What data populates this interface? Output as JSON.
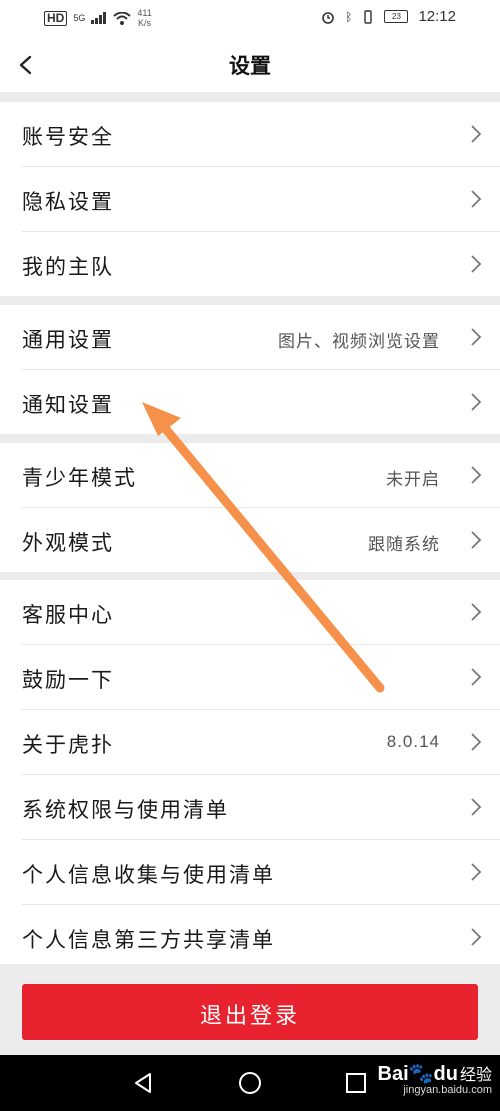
{
  "status_bar": {
    "network": "HD",
    "signal": "5G",
    "speed_value": "411",
    "speed_unit": "K/s",
    "battery": "23",
    "time": "12:12"
  },
  "nav": {
    "title": "设置"
  },
  "groups": [
    {
      "items": [
        {
          "label": "账号安全",
          "value": ""
        },
        {
          "label": "隐私设置",
          "value": ""
        },
        {
          "label": "我的主队",
          "value": ""
        }
      ]
    },
    {
      "items": [
        {
          "label": "通用设置",
          "value": "图片、视频浏览设置"
        },
        {
          "label": "通知设置",
          "value": ""
        }
      ]
    },
    {
      "items": [
        {
          "label": "青少年模式",
          "value": "未开启"
        },
        {
          "label": "外观模式",
          "value": "跟随系统"
        }
      ]
    },
    {
      "items": [
        {
          "label": "客服中心",
          "value": ""
        },
        {
          "label": "鼓励一下",
          "value": ""
        },
        {
          "label": "关于虎扑",
          "value": "8.0.14"
        },
        {
          "label": "系统权限与使用清单",
          "value": ""
        },
        {
          "label": "个人信息收集与使用清单",
          "value": ""
        },
        {
          "label": "个人信息第三方共享清单",
          "value": ""
        }
      ]
    }
  ],
  "logout": {
    "label": "退出登录",
    "color": "#e8222e"
  },
  "watermark": {
    "logo": "Bai",
    "logo_tail": "du",
    "text": "经验",
    "sub": "jingyan.baidu.com"
  },
  "annotation": {
    "arrow_color": "#f5914a"
  },
  "icons": {
    "back": "chevron-left-icon",
    "row_chevron": "chevron-right-icon",
    "sys_back": "triangle-back-icon",
    "sys_home": "circle-home-icon",
    "sys_recents": "square-recents-icon"
  }
}
